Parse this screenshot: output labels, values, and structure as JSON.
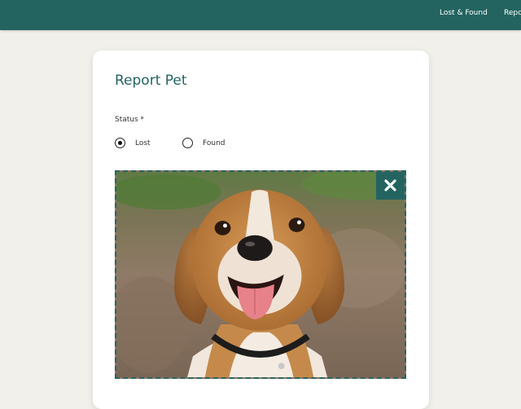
{
  "nav": {
    "items": [
      {
        "label": "Lost & Found"
      },
      {
        "label": "Repo"
      }
    ]
  },
  "form": {
    "title": "Report Pet",
    "status_label": "Status *",
    "status_options": [
      {
        "label": "Lost",
        "selected": true
      },
      {
        "label": "Found",
        "selected": false
      }
    ],
    "photo": {
      "subject": "beagle dog photo",
      "remove_icon": "close-icon"
    }
  },
  "colors": {
    "brand": "#236461",
    "background": "#f1f0ea",
    "card": "#ffffff"
  }
}
